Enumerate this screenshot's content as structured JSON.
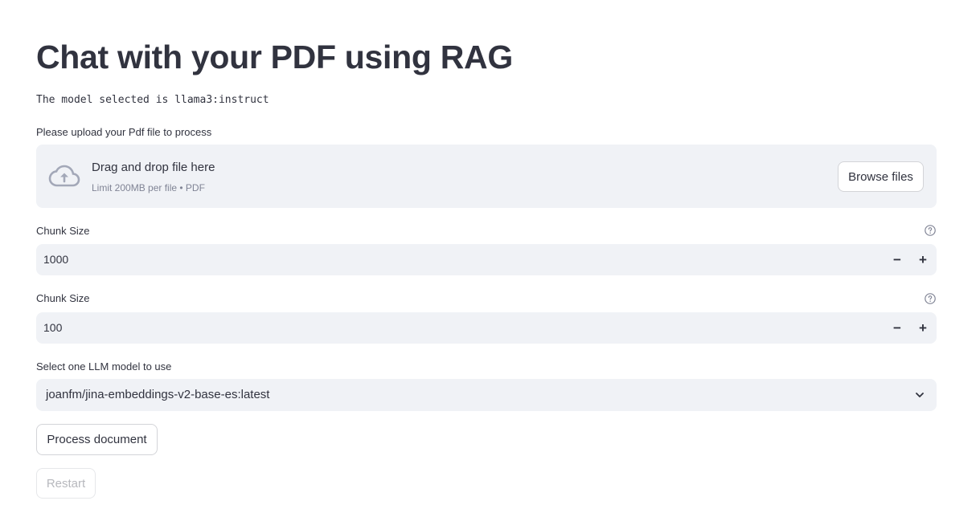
{
  "page": {
    "title": "Chat with your PDF using RAG",
    "model_line": "The model selected is llama3:instruct"
  },
  "uploader": {
    "label": "Please upload your Pdf file to process",
    "drop_text": "Drag and drop file here",
    "limit_text": "Limit 200MB per file • PDF",
    "browse_label": "Browse files",
    "icon": "cloud-upload-icon"
  },
  "chunk_size": {
    "label": "Chunk Size",
    "value": "1000",
    "minus": "−",
    "plus": "+"
  },
  "chunk_overlap": {
    "label": "Chunk Size",
    "value": "100",
    "minus": "−",
    "plus": "+"
  },
  "model_select": {
    "label": "Select one LLM model to use",
    "selected": "joanfm/jina-embeddings-v2-base-es:latest"
  },
  "actions": {
    "process_label": "Process document",
    "restart_label": "Restart"
  },
  "colors": {
    "text": "#31333f",
    "input_bg": "#f0f2f6",
    "muted": "#808495",
    "icon": "#a3a8b8"
  }
}
